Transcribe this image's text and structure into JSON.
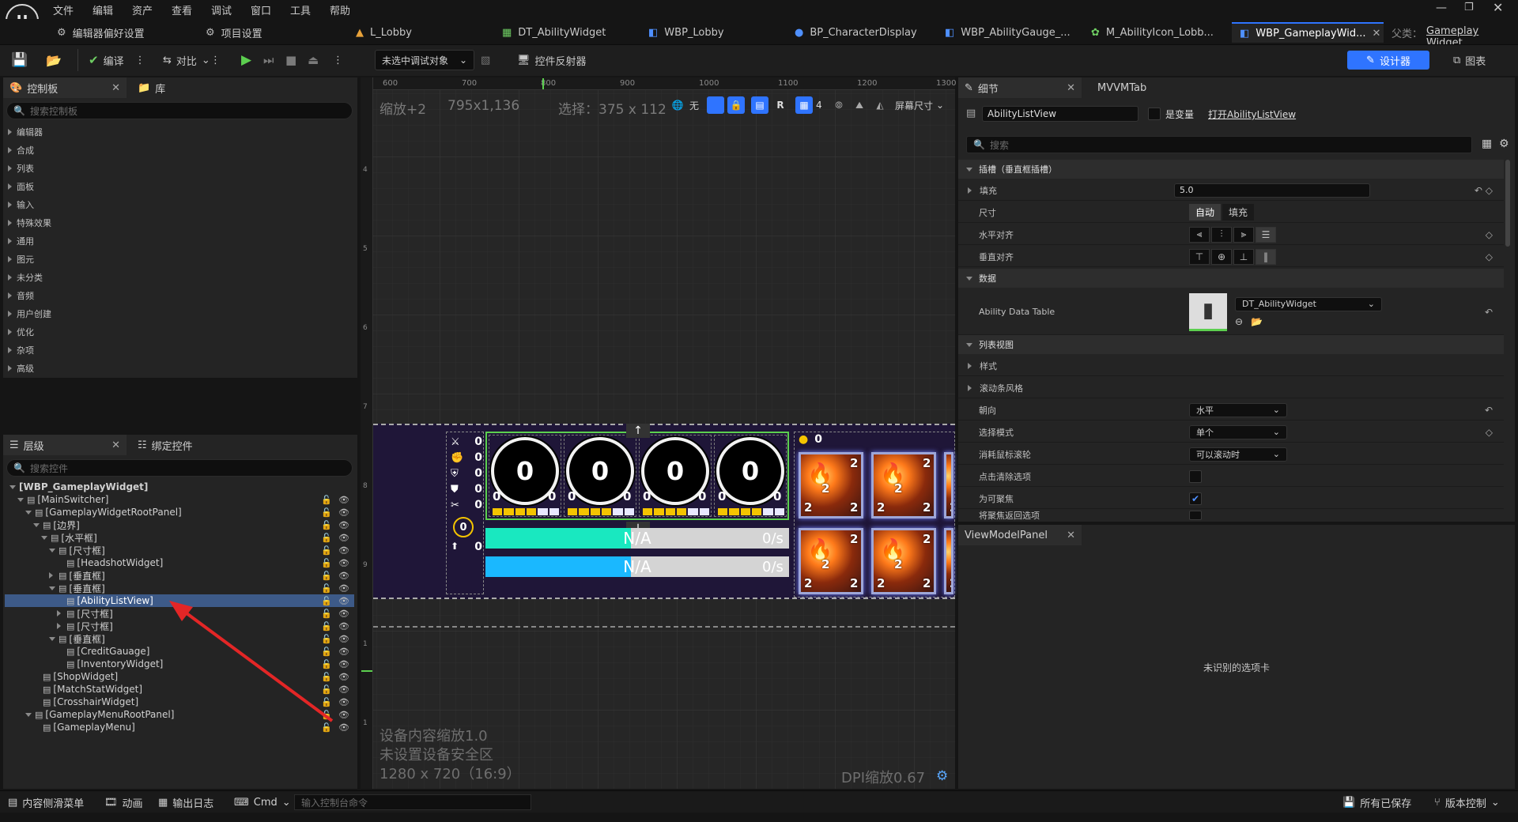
{
  "menu": [
    "文件",
    "编辑",
    "资产",
    "查看",
    "调试",
    "窗口",
    "工具",
    "帮助"
  ],
  "tabs": [
    {
      "label": "编辑器偏好设置",
      "active": false
    },
    {
      "label": "项目设置",
      "active": false
    },
    {
      "label": "L_Lobby",
      "active": false
    },
    {
      "label": "DT_AbilityWidget",
      "active": false
    },
    {
      "label": "WBP_Lobby",
      "active": false
    },
    {
      "label": "BP_CharacterDisplay",
      "active": false
    },
    {
      "label": "WBP_AbilityGauge_...",
      "active": false
    },
    {
      "label": "M_AbilityIcon_Lobb...",
      "active": false
    },
    {
      "label": "WBP_GameplayWid...",
      "active": true
    }
  ],
  "parent": {
    "label": "父类：",
    "value": "Gameplay Widget"
  },
  "toolbar": {
    "compile": "编译",
    "diff": "对比",
    "debug_target": "未选中调试对象",
    "reflector": "控件反射器",
    "designer": "设计器",
    "graph": "图表"
  },
  "palette": {
    "tab1": "控制板",
    "tab2": "库",
    "search_placeholder": "搜索控制板",
    "categories": [
      "编辑器",
      "合成",
      "列表",
      "面板",
      "输入",
      "特殊效果",
      "通用",
      "图元",
      "未分类",
      "音频",
      "用户创建",
      "优化",
      "杂项",
      "高级"
    ]
  },
  "hierarchy": {
    "tab1": "层级",
    "tab2": "绑定控件",
    "search_placeholder": "搜索控件",
    "rows": [
      {
        "label": "[WBP_GameplayWidget]",
        "depth": 0,
        "arrow": "down",
        "root": true
      },
      {
        "label": "[MainSwitcher]",
        "depth": 1,
        "arrow": "down"
      },
      {
        "label": "[GameplayWidgetRootPanel]",
        "depth": 2,
        "arrow": "down"
      },
      {
        "label": "[边界]",
        "depth": 3,
        "arrow": "down"
      },
      {
        "label": "[水平框]",
        "depth": 4,
        "arrow": "down"
      },
      {
        "label": "[尺寸框]",
        "depth": 5,
        "arrow": "down"
      },
      {
        "label": "[HeadshotWidget]",
        "depth": 6,
        "arrow": ""
      },
      {
        "label": "[垂直框]",
        "depth": 5,
        "arrow": "right"
      },
      {
        "label": "[垂直框]",
        "depth": 5,
        "arrow": "down"
      },
      {
        "label": "[AbilityListView]",
        "depth": 6,
        "arrow": "",
        "selected": true
      },
      {
        "label": "[尺寸框]",
        "depth": 6,
        "arrow": "right"
      },
      {
        "label": "[尺寸框]",
        "depth": 6,
        "arrow": "right"
      },
      {
        "label": "[垂直框]",
        "depth": 5,
        "arrow": "down"
      },
      {
        "label": "[CreditGauage]",
        "depth": 6,
        "arrow": ""
      },
      {
        "label": "[InventoryWidget]",
        "depth": 6,
        "arrow": ""
      },
      {
        "label": "[ShopWidget]",
        "depth": 3,
        "arrow": ""
      },
      {
        "label": "[MatchStatWidget]",
        "depth": 3,
        "arrow": ""
      },
      {
        "label": "[CrosshairWidget]",
        "depth": 3,
        "arrow": ""
      },
      {
        "label": "[GameplayMenuRootPanel]",
        "depth": 2,
        "arrow": "down"
      },
      {
        "label": "[GameplayMenu]",
        "depth": 3,
        "arrow": ""
      }
    ]
  },
  "canvas": {
    "ruler_labels": [
      "600",
      "700",
      "800",
      "900",
      "1000",
      "1100",
      "1200",
      "1300"
    ],
    "vruler_labels": [
      "4",
      "5",
      "6",
      "7",
      "8",
      "9",
      "1",
      "1"
    ],
    "zoom": "缩放+2",
    "size": "795x1,136",
    "selection": "选择：375 x 112",
    "none": "无",
    "r": "R",
    "grid": "4",
    "screen": "屏幕尺寸",
    "info1": "设备内容缩放1.0",
    "info2": "未设置设备安全区",
    "info3": "1280 x 720（16:9）",
    "dpi": "DPI缩放0.67",
    "stat_values": [
      "0",
      "0",
      "0",
      "0",
      "0",
      "0"
    ],
    "ring_values": [
      "0",
      "0",
      "0",
      "0"
    ],
    "ring_sub": [
      "0",
      "0"
    ],
    "bar_text": "N/A",
    "bar_rate": "0/s",
    "card_count": "0",
    "card_nums": [
      "2",
      "2",
      "2"
    ]
  },
  "details": {
    "tab1": "细节",
    "tab2": "MVVMTab",
    "name": "AbilityListView",
    "is_var": "是变量",
    "open_link": "打开AbilityListView",
    "search_placeholder": "搜索",
    "sections": {
      "slot": "插槽（垂直框插槽）",
      "data": "数据",
      "listview": "列表视图"
    },
    "fill_label": "填充",
    "fill_value": "5.0",
    "size_label": "尺寸",
    "size_auto": "自动",
    "size_fill": "填充",
    "halign": "水平对齐",
    "valign": "垂直对齐",
    "data_table_label": "Ability Data Table",
    "data_table_value": "DT_AbilityWidget",
    "style": "样式",
    "scroll_style": "滚动条风格",
    "orientation_label": "朝向",
    "orientation_value": "水平",
    "selection_label": "选择模式",
    "selection_value": "单个",
    "wheel_label": "消耗鼠标滚轮",
    "wheel_value": "可以滚动时",
    "click_clear": "点击清除选项",
    "focusable": "为可聚焦",
    "return_focus": "将聚焦返回选项"
  },
  "viewmodel": {
    "tab": "ViewModelPanel",
    "message": "未识别的选项卡"
  },
  "statusbar": {
    "content_drawer": "内容侧滑菜单",
    "anim": "动画",
    "output": "输出日志",
    "cmd": "Cmd",
    "cmd_placeholder": "输入控制台命令",
    "saved": "所有已保存",
    "source": "版本控制"
  },
  "colors": {
    "accent": "#2f74ff",
    "cyan_bar": "#19e8c0",
    "blue_bar": "#1ab8ff",
    "gold": "#f4c400"
  }
}
